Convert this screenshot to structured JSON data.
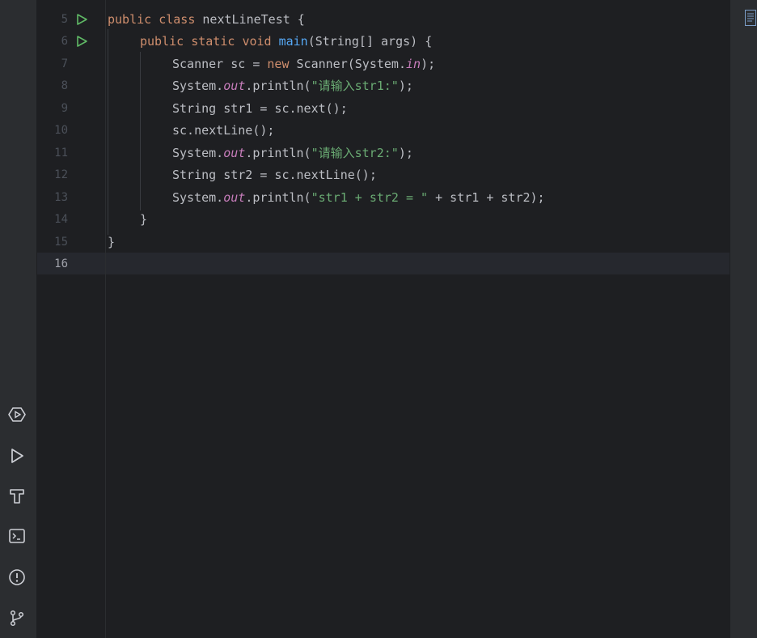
{
  "colors": {
    "background": "#1e1f22",
    "toolbar": "#2b2d30",
    "keyword": "#cf8e6d",
    "function": "#56a8f5",
    "string": "#6aab73",
    "static_field": "#c77dbb",
    "run_icon": "#5fb865"
  },
  "left_toolbar": {
    "items": [
      {
        "name": "services-icon"
      },
      {
        "name": "run-icon"
      },
      {
        "name": "build-icon"
      },
      {
        "name": "terminal-icon"
      },
      {
        "name": "problems-icon"
      },
      {
        "name": "git-icon"
      }
    ]
  },
  "editor": {
    "line_numbers": [
      "5",
      "6",
      "7",
      "8",
      "9",
      "10",
      "11",
      "12",
      "13",
      "14",
      "15",
      "16"
    ],
    "current_line": "16",
    "run_gutter_lines": [
      "5",
      "6"
    ],
    "code": {
      "l5": {
        "kw1": "public",
        "kw2": "class",
        "rest": "nextLineTest {"
      },
      "l6": {
        "kw1": "public",
        "kw2": "static",
        "kw3": "void",
        "fn": "main",
        "rest": "(String[] args) {"
      },
      "l7": {
        "a": "Scanner sc = ",
        "kw": "new",
        "b": " Scanner(System.",
        "fld": "in",
        "c": ");"
      },
      "l8": {
        "a": "System.",
        "fld": "out",
        "b": ".println(",
        "str": "\"请输入str1:\"",
        "c": ");"
      },
      "l9": {
        "a": "String str1 = sc.next();"
      },
      "l10": {
        "a": "sc.nextLine();"
      },
      "l11": {
        "a": "System.",
        "fld": "out",
        "b": ".println(",
        "str": "\"请输入str2:\"",
        "c": ");"
      },
      "l12": {
        "a": "String str2 = sc.nextLine();"
      },
      "l13": {
        "a": "System.",
        "fld": "out",
        "b": ".println(",
        "str": "\"str1 + str2 = \"",
        "c": " + str1 + str2);"
      },
      "l14": {
        "a": "}"
      },
      "l15": {
        "a": "}"
      },
      "l16": {
        "a": ""
      }
    }
  },
  "right_strip": {
    "widget": "inspection-widget-icon"
  }
}
